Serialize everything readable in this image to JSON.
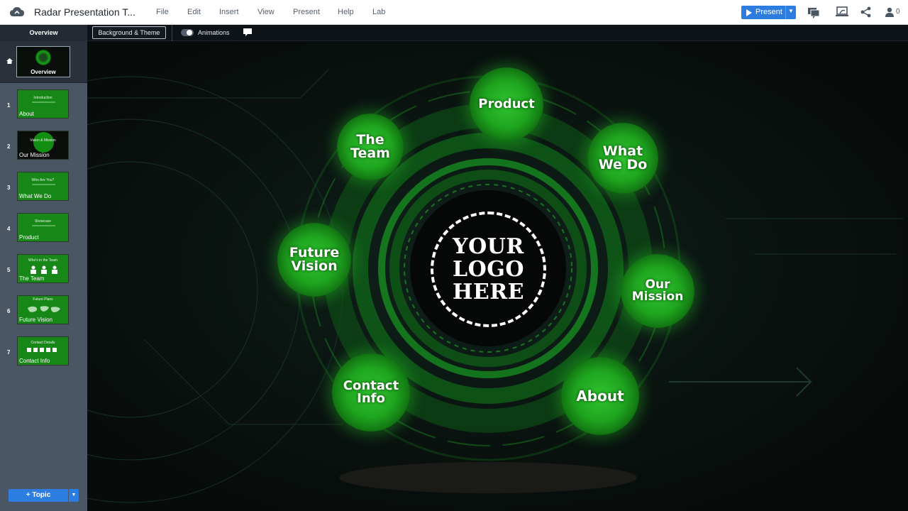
{
  "app": {
    "title": "Radar Presentation T...",
    "menu": [
      "File",
      "Edit",
      "Insert",
      "View",
      "Present",
      "Help",
      "Lab"
    ],
    "present_label": "Present",
    "collab_count": "0",
    "accent_color": "#2d7de0"
  },
  "toolbar": {
    "background_theme_label": "Background & Theme",
    "animations_label": "Animations",
    "animations_on": true
  },
  "sidebar": {
    "header": "Overview",
    "overview_thumb_label": "Overview",
    "slides": [
      {
        "num": "1",
        "label": "About",
        "thumb_title": "Introduction"
      },
      {
        "num": "2",
        "label": "Our Mission",
        "thumb_title": "Vision & Mission"
      },
      {
        "num": "3",
        "label": "What We Do",
        "thumb_title": "Who Are You?"
      },
      {
        "num": "4",
        "label": "Product",
        "thumb_title": "Showcase"
      },
      {
        "num": "5",
        "label": "The Team",
        "thumb_title": "Who's in the Team"
      },
      {
        "num": "6",
        "label": "Future Vision",
        "thumb_title": "Future Plans"
      },
      {
        "num": "7",
        "label": "Contact Info",
        "thumb_title": "Contact Details"
      }
    ],
    "topic_button": "+ Topic"
  },
  "canvas": {
    "logo_text": "YOUR\nLOGO\nHERE",
    "nodes": {
      "product": "Product",
      "what_we_do": "What\nWe Do",
      "our_mission": "Our\nMission",
      "about": "About",
      "contact_info": "Contact\nInfo",
      "future_vision": "Future\nVision",
      "the_team": "The\nTeam"
    },
    "theme_green": "#1fa51f"
  }
}
